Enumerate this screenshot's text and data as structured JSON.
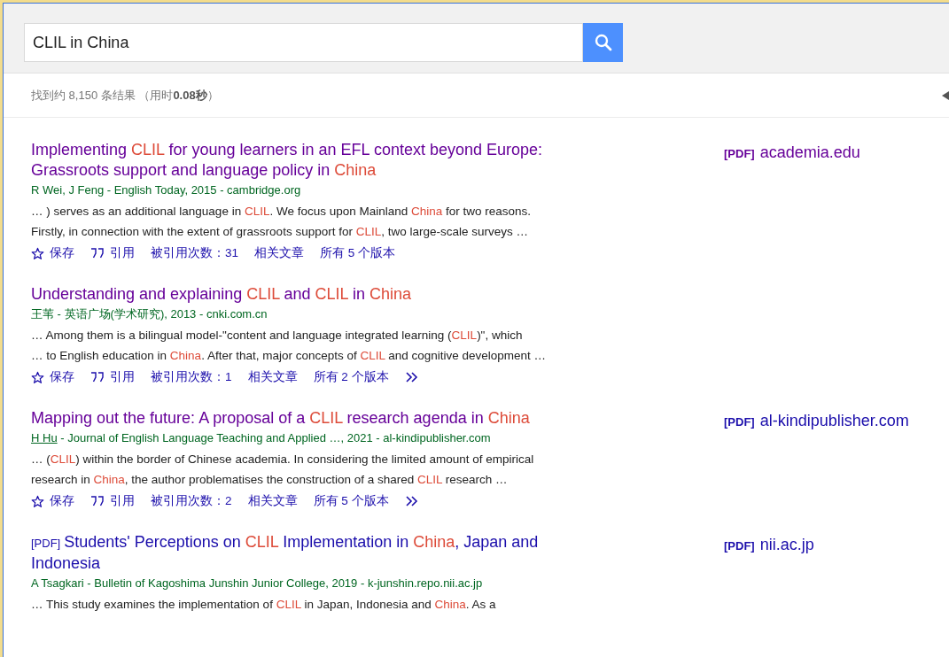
{
  "search": {
    "query": "CLIL in China"
  },
  "stats": {
    "prefix": "找到约 8,150 条结果 （用时",
    "time": "0.08秒",
    "suffix": "）"
  },
  "results": [
    {
      "visited": true,
      "title": [
        {
          "text": "Implementing ",
          "hl": false
        },
        {
          "text": "CLIL",
          "hl": true
        },
        {
          "text": " for young learners in an EFL context beyond Europe: Grassroots support and language policy in ",
          "hl": false
        },
        {
          "text": "China",
          "hl": true
        }
      ],
      "author": "R Wei, J Feng",
      "author_underlined": false,
      "source": " - English Today, 2015 - cambridge.org",
      "snippet": [
        [
          {
            "text": "… ) serves as an additional language in ",
            "hl": false
          },
          {
            "text": "CLIL",
            "hl": true
          },
          {
            "text": ". We focus upon Mainland ",
            "hl": false
          },
          {
            "text": "China",
            "hl": true
          },
          {
            "text": " for two reasons.",
            "hl": false
          }
        ],
        [
          {
            "text": "Firstly, in connection with the extent of grassroots support for ",
            "hl": false
          },
          {
            "text": "CLIL",
            "hl": true
          },
          {
            "text": ", two large-scale surveys …",
            "hl": false
          }
        ]
      ],
      "actions": {
        "save": "保存",
        "cite": "引用",
        "cited_by": "被引用次数：31",
        "related": "相关文章",
        "versions": "所有 5 个版本",
        "more": false
      },
      "side": {
        "tag": "[PDF]",
        "domain": "academia.edu",
        "visited": true
      }
    },
    {
      "visited": true,
      "title": [
        {
          "text": "Understanding and explaining ",
          "hl": false
        },
        {
          "text": "CLIL",
          "hl": true
        },
        {
          "text": " and ",
          "hl": false
        },
        {
          "text": "CLIL",
          "hl": true
        },
        {
          "text": " in ",
          "hl": false
        },
        {
          "text": "China",
          "hl": true
        }
      ],
      "author": "王苇",
      "author_underlined": false,
      "source": " - 英语广场(学术研究), 2013 - cnki.com.cn",
      "snippet": [
        [
          {
            "text": "… Among them is a bilingual model-\"content and language integrated learning (",
            "hl": false
          },
          {
            "text": "CLIL",
            "hl": true
          },
          {
            "text": ")\", which",
            "hl": false
          }
        ],
        [
          {
            "text": "… to English education in ",
            "hl": false
          },
          {
            "text": "China",
            "hl": true
          },
          {
            "text": ". After that, major concepts of ",
            "hl": false
          },
          {
            "text": "CLIL",
            "hl": true
          },
          {
            "text": " and cognitive development …",
            "hl": false
          }
        ]
      ],
      "actions": {
        "save": "保存",
        "cite": "引用",
        "cited_by": "被引用次数：1",
        "related": "相关文章",
        "versions": "所有 2 个版本",
        "more": true
      }
    },
    {
      "visited": true,
      "title": [
        {
          "text": "Mapping out the future: A proposal of a ",
          "hl": false
        },
        {
          "text": "CLIL",
          "hl": true
        },
        {
          "text": " research agenda in ",
          "hl": false
        },
        {
          "text": "China",
          "hl": true
        }
      ],
      "author": "H Hu",
      "author_underlined": true,
      "source": " - Journal of English Language Teaching and Applied …, 2021 - al-kindipublisher.com",
      "snippet": [
        [
          {
            "text": "… (",
            "hl": false
          },
          {
            "text": "CLIL",
            "hl": true
          },
          {
            "text": ") within the border of Chinese academia. In considering the limited amount of empirical",
            "hl": false
          }
        ],
        [
          {
            "text": "research in ",
            "hl": false
          },
          {
            "text": "China",
            "hl": true
          },
          {
            "text": ", the author problematises the construction of a shared ",
            "hl": false
          },
          {
            "text": "CLIL",
            "hl": true
          },
          {
            "text": " research …",
            "hl": false
          }
        ]
      ],
      "actions": {
        "save": "保存",
        "cite": "引用",
        "cited_by": "被引用次数：2",
        "related": "相关文章",
        "versions": "所有 5 个版本",
        "more": true
      },
      "side": {
        "tag": "[PDF]",
        "domain": "al-kindipublisher.com",
        "visited": false
      }
    },
    {
      "visited": false,
      "pdf_tag": "[PDF]",
      "title": [
        {
          "text": "Students' Perceptions on ",
          "hl": false
        },
        {
          "text": "CLIL",
          "hl": true
        },
        {
          "text": " Implementation in ",
          "hl": false
        },
        {
          "text": "China",
          "hl": true
        },
        {
          "text": ", Japan and Indonesia",
          "hl": false
        }
      ],
      "author": "A Tsagkari",
      "author_underlined": false,
      "source": " - Bulletin of Kagoshima Junshin Junior College, 2019 - k-junshin.repo.nii.ac.jp",
      "snippet": [
        [
          {
            "text": "… This study examines the implementation of ",
            "hl": false
          },
          {
            "text": "CLIL",
            "hl": true
          },
          {
            "text": " in Japan, Indonesia and ",
            "hl": false
          },
          {
            "text": "China",
            "hl": true
          },
          {
            "text": ". As a",
            "hl": false
          }
        ]
      ],
      "side": {
        "tag": "[PDF]",
        "domain": "nii.ac.jp",
        "visited": false
      }
    }
  ]
}
